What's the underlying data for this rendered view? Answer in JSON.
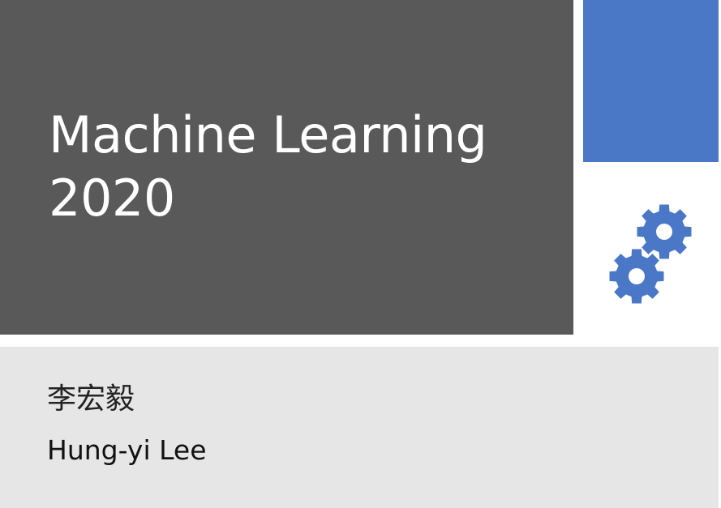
{
  "slide": {
    "title_lines": [
      "Machine Learning",
      "2020"
    ],
    "author_chinese": "李宏毅",
    "author_english": "Hung-yi Lee",
    "gears_icon": "gears-icon"
  },
  "colors": {
    "title_panel": "#595959",
    "accent_block": "#4a78c6",
    "author_panel": "#e6e6e6",
    "gear": "#4a78c6",
    "title_text": "#ffffff"
  }
}
